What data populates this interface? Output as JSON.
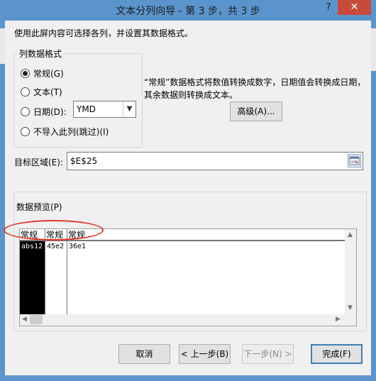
{
  "window": {
    "title": "文本分列向导 - 第 3 步，共 3 步",
    "help_label": "?",
    "close_label": "✕"
  },
  "intro": "使用此屏内容可选择各列，并设置其数据格式。",
  "column_format": {
    "legend": "列数据格式",
    "options": [
      {
        "label": "常规(G)",
        "checked": true
      },
      {
        "label": "文本(T)",
        "checked": false
      },
      {
        "label": "日期(D):",
        "checked": false
      },
      {
        "label": "不导入此列(跳过)(I)",
        "checked": false
      }
    ],
    "date_format": "YMD"
  },
  "description": "“常规”数据格式将数值转换成数字，日期值会转换成日期，其余数据则转换成文本。",
  "advanced_button": "高级(A)...",
  "destination": {
    "label": "目标区域(E):",
    "value": "$E$25"
  },
  "preview": {
    "legend": "数据预览(P)",
    "headers": [
      "常规",
      "常规",
      "常规"
    ],
    "cells": [
      "abs12",
      "45e2",
      "36e1"
    ]
  },
  "buttons": {
    "cancel": "取消",
    "prev": "< 上一步(B)",
    "next": "下一步(N) >",
    "finish": "完成(F)"
  }
}
